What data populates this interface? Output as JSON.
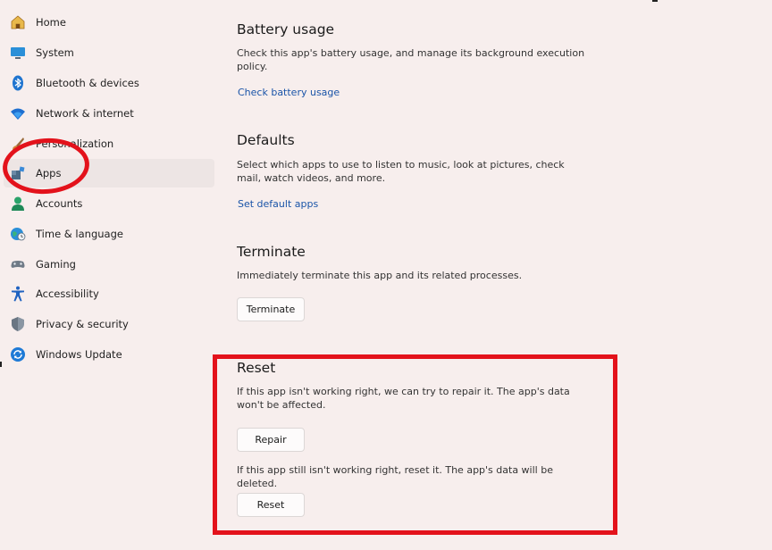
{
  "sidebar": {
    "items": [
      {
        "label": "Home",
        "icon": "home-icon"
      },
      {
        "label": "System",
        "icon": "system-icon"
      },
      {
        "label": "Bluetooth & devices",
        "icon": "bluetooth-icon"
      },
      {
        "label": "Network & internet",
        "icon": "wifi-icon"
      },
      {
        "label": "Personalization",
        "icon": "brush-icon"
      },
      {
        "label": "Apps",
        "icon": "apps-icon"
      },
      {
        "label": "Accounts",
        "icon": "account-icon"
      },
      {
        "label": "Time & language",
        "icon": "globe-clock-icon"
      },
      {
        "label": "Gaming",
        "icon": "gamepad-icon"
      },
      {
        "label": "Accessibility",
        "icon": "accessibility-icon"
      },
      {
        "label": "Privacy & security",
        "icon": "shield-icon"
      },
      {
        "label": "Windows Update",
        "icon": "update-icon"
      }
    ],
    "selected": "Apps"
  },
  "battery": {
    "title": "Battery usage",
    "description": "Check this app's battery usage, and manage its background execution policy.",
    "link": "Check battery usage"
  },
  "defaults": {
    "title": "Defaults",
    "description": "Select which apps to use to listen to music, look at pictures, check mail, watch videos, and more.",
    "link": "Set default apps"
  },
  "terminate": {
    "title": "Terminate",
    "description": "Immediately terminate this app and its related processes.",
    "button": "Terminate"
  },
  "reset": {
    "title": "Reset",
    "repair_description": "If this app isn't working right, we can try to repair it. The app's data won't be affected.",
    "repair_button": "Repair",
    "reset_description": "If this app still isn't working right, reset it. The app's data will be deleted.",
    "reset_button": "Reset"
  },
  "colors": {
    "background": "#f7eeed",
    "accent": "#1a54a8",
    "annotation": "#e3121b"
  }
}
